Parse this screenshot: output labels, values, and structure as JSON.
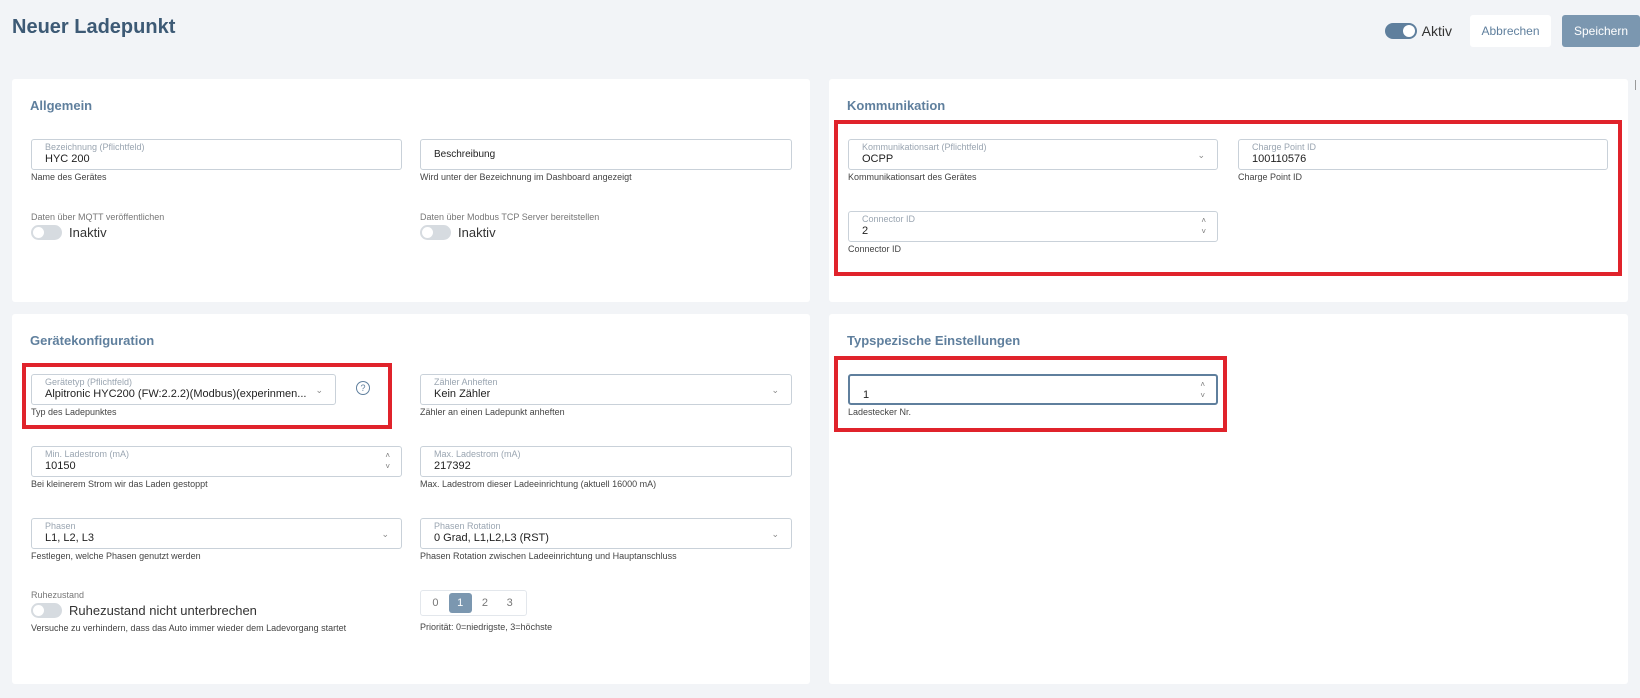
{
  "header": {
    "title": "Neuer Ladepunkt",
    "active_label": "Aktiv",
    "cancel_label": "Abbrechen",
    "save_label": "Speichern"
  },
  "allgemein": {
    "title": "Allgemein",
    "bezeichnung": {
      "label": "Bezeichnung (Pflichtfeld)",
      "value": "HYC 200",
      "helper": "Name des Gerätes"
    },
    "beschreibung": {
      "placeholder": "Beschreibung",
      "helper": "Wird unter der Bezeichnung im Dashboard angezeigt"
    },
    "mqtt": {
      "label": "Daten über MQTT veröffentlichen",
      "state": "Inaktiv"
    },
    "modbus": {
      "label": "Daten über Modbus TCP Server bereitstellen",
      "state": "Inaktiv"
    }
  },
  "kommunikation": {
    "title": "Kommunikation",
    "art": {
      "label": "Kommunikationsart (Pflichtfeld)",
      "value": "OCPP",
      "helper": "Kommunikationsart des Gerätes"
    },
    "charge_point_id": {
      "label": "Charge Point ID",
      "value": "100110576",
      "helper": "Charge Point ID"
    },
    "connector_id": {
      "label": "Connector ID",
      "value": "2",
      "helper": "Connector ID"
    }
  },
  "geraetekonfiguration": {
    "title": "Gerätekonfiguration",
    "geraetetyp": {
      "label": "Gerätetyp (Pflichtfeld)",
      "value": "Alpitronic HYC200 (FW:2.2.2)(Modbus)(experinmen...",
      "helper": "Typ des Ladepunktes",
      "help_icon": "question-icon"
    },
    "zaehler": {
      "label": "Zähler Anheften",
      "value": "Kein Zähler",
      "helper": "Zähler an einen Ladepunkt anheften"
    },
    "min_strom": {
      "label": "Min. Ladestrom (mA)",
      "value": "10150",
      "helper": "Bei kleinerem Strom wir das Laden gestoppt"
    },
    "max_strom": {
      "label": "Max. Ladestrom (mA)",
      "value": "217392",
      "helper": "Max. Ladestrom dieser Ladeeinrichtung (aktuell 16000 mA)"
    },
    "phasen": {
      "label": "Phasen",
      "value": "L1, L2, L3",
      "helper": "Festlegen, welche Phasen genutzt werden"
    },
    "phasen_rotation": {
      "label": "Phasen Rotation",
      "value": "0 Grad, L1,L2,L3 (RST)",
      "helper": "Phasen Rotation zwischen Ladeeinrichtung und Hauptanschluss"
    },
    "ruhezustand": {
      "label": "Ruhezustand",
      "state": "Ruhezustand nicht unterbrechen",
      "helper": "Versuche zu verhindern, dass das Auto immer wieder dem Ladevorgang startet"
    },
    "prioritaet": {
      "options": [
        "0",
        "1",
        "2",
        "3"
      ],
      "selected": "1",
      "helper": "Priorität: 0=niedrigste, 3=höchste"
    }
  },
  "typspezifisch": {
    "title": "Typspezische Einstellungen",
    "ladestecker": {
      "value": "1",
      "helper": "Ladestecker Nr."
    }
  },
  "colors": {
    "accent": "#5f7f9d",
    "highlight": "#e0232b",
    "title": "#3d5a75"
  }
}
